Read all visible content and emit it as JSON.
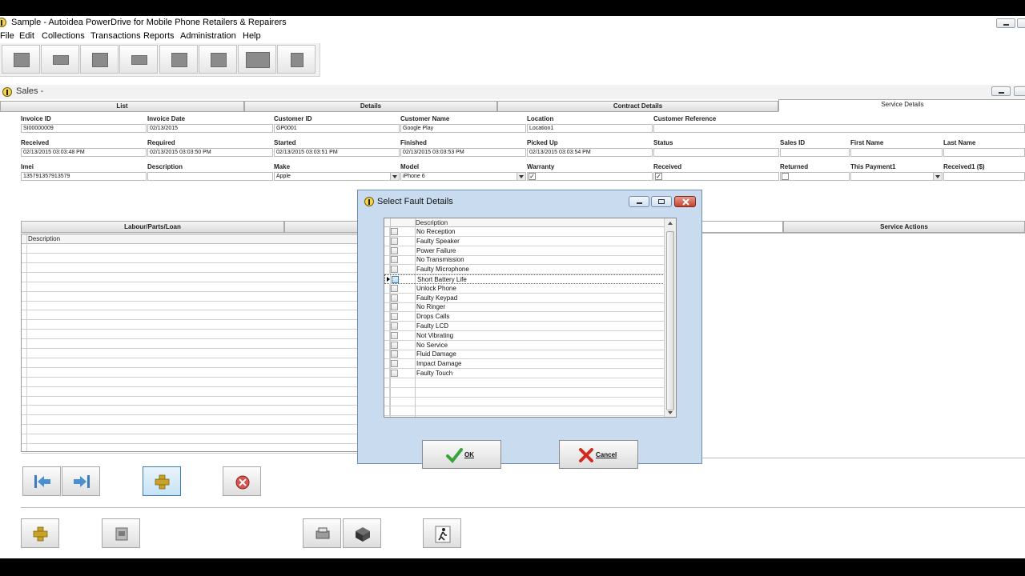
{
  "window": {
    "title": "Sample - Autoidea PowerDrive for Mobile Phone Retailers & Repairers"
  },
  "menu": [
    "File",
    "Edit",
    "Collections",
    "Transactions",
    "Reports",
    "Administration",
    "Help"
  ],
  "sales": {
    "title": "Sales -"
  },
  "tabs": {
    "list": "List",
    "details": "Details",
    "contract": "Contract Details",
    "service": "Service Details"
  },
  "fields": {
    "invoice_id": {
      "label": "Invoice ID",
      "value": "SI00000009"
    },
    "invoice_date": {
      "label": "Invoice Date",
      "value": "02/13/2015"
    },
    "customer_id": {
      "label": "Customer ID",
      "value": "GP0001"
    },
    "customer_name": {
      "label": "Customer Name",
      "value": "Google Play"
    },
    "location": {
      "label": "Location",
      "value": "Location1"
    },
    "customer_reference": {
      "label": "Customer Reference",
      "value": ""
    },
    "received": {
      "label": "Received",
      "value": "02/13/2015 03:03:48 PM"
    },
    "required": {
      "label": "Required",
      "value": "02/13/2015 03:03:50 PM"
    },
    "started": {
      "label": "Started",
      "value": "02/13/2015 03:03:51 PM"
    },
    "finished": {
      "label": "Finished",
      "value": "02/13/2015 03:03:53 PM"
    },
    "picked_up": {
      "label": "Picked Up",
      "value": "02/13/2015 03:03:54 PM"
    },
    "status": {
      "label": "Status",
      "value": ""
    },
    "sales_id": {
      "label": "Sales ID",
      "value": ""
    },
    "first_name": {
      "label": "First Name",
      "value": ""
    },
    "last_name": {
      "label": "Last Name",
      "value": ""
    },
    "imei": {
      "label": "Imei",
      "value": "135791357913579"
    },
    "description": {
      "label": "Description",
      "value": ""
    },
    "make": {
      "label": "Make",
      "value": "Apple"
    },
    "model": {
      "label": "Model",
      "value": "iPhone 6"
    },
    "warranty": {
      "label": "Warranty",
      "value": "✓"
    },
    "received_chk": {
      "label": "Received",
      "value": "✓"
    },
    "returned": {
      "label": "Returned",
      "value": ""
    },
    "this_payment": {
      "label": "This Payment1",
      "value": ""
    },
    "received_amount": {
      "label": "Received1 ($)",
      "value": ""
    }
  },
  "subtabs": {
    "labour": "Labour/Parts/Loan",
    "service_actions": "Service Actions"
  },
  "lower_grid": {
    "header": "Description"
  },
  "dialog": {
    "title": "Select Fault Details",
    "column": "Description",
    "items": [
      "No Reception",
      "Faulty Speaker",
      "Power Failure",
      "No Transmission",
      "Faulty Microphone",
      "Short Battery Life",
      "Unlock Phone",
      "Faulty Keypad",
      "No Ringer",
      "Drops Calls",
      "Faulty LCD",
      "Not Vibrating",
      "No Service",
      "Fluid Damage",
      "Impact Damage",
      "Faulty Touch"
    ],
    "current_index": 5,
    "ok_label": "OK",
    "cancel_label": "Cancel"
  },
  "colors": {
    "dialog_bg": "#c9dcef",
    "ok_green": "#3aa33a",
    "cancel_red": "#d12b1f",
    "add_plus": "#c9a227"
  }
}
